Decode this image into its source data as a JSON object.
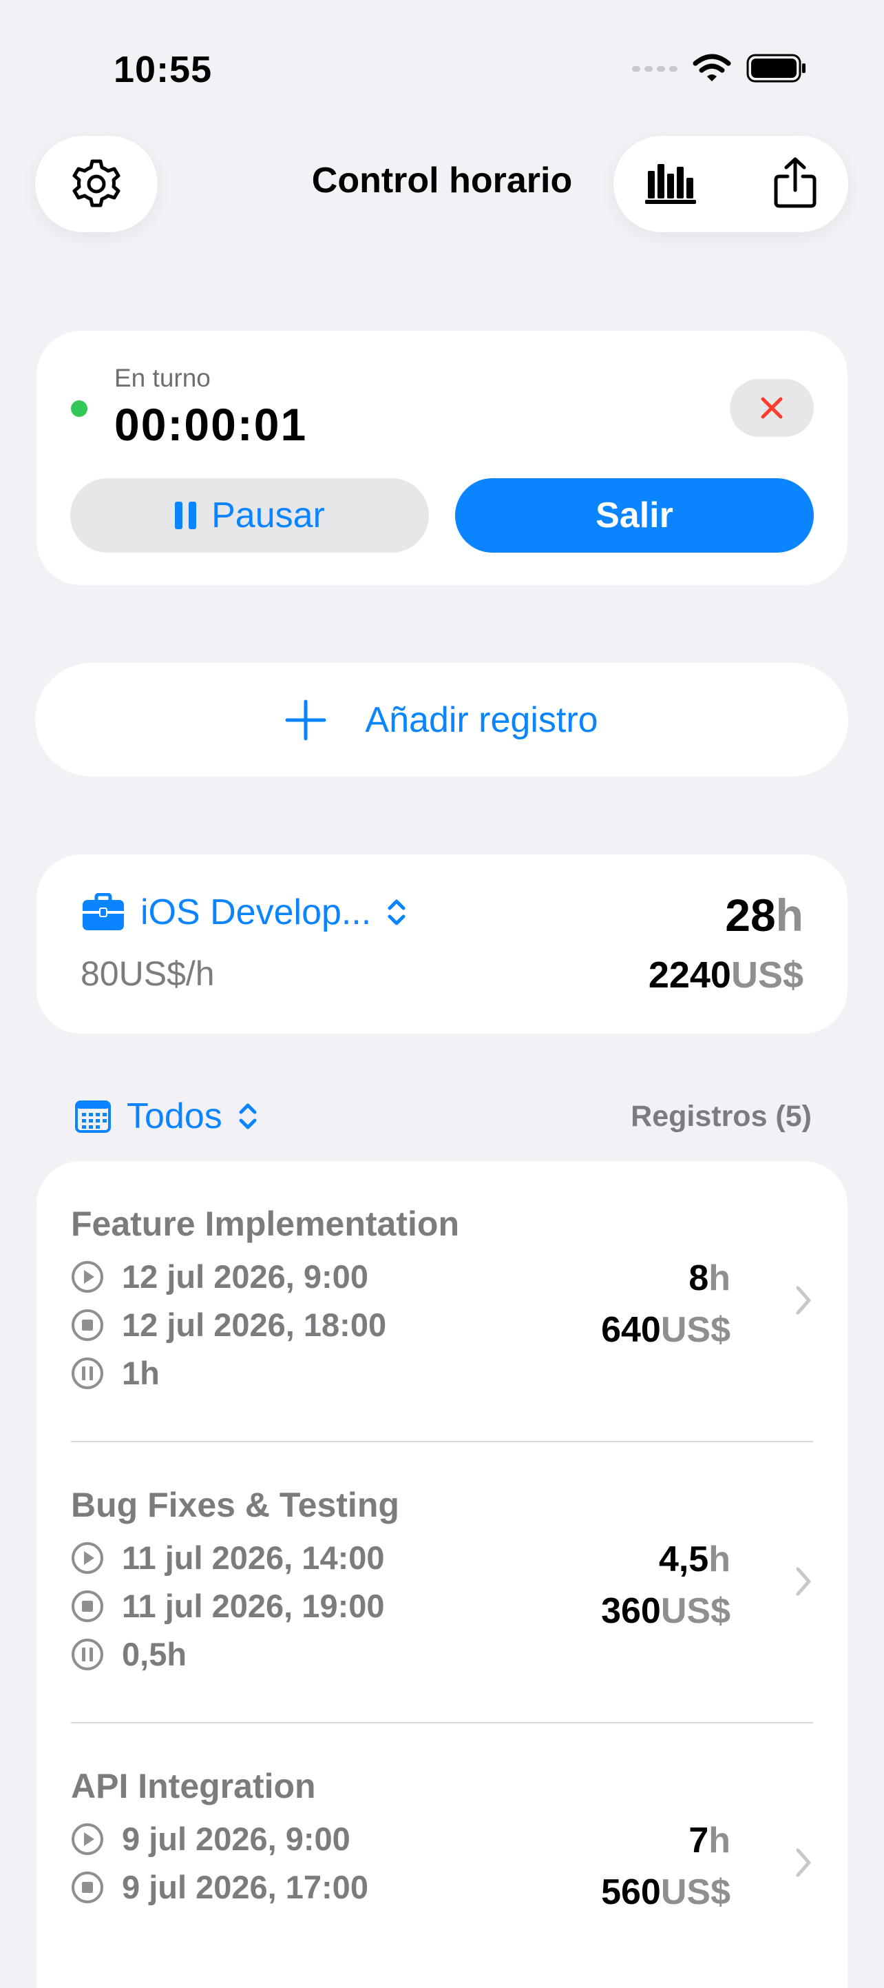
{
  "status_bar": {
    "time": "10:55"
  },
  "header": {
    "title": "Control horario"
  },
  "shift": {
    "label": "En turno",
    "timer": "00:00:01",
    "pause_label": "Pausar",
    "exit_label": "Salir"
  },
  "add_record": {
    "label": "Añadir registro"
  },
  "project": {
    "name": "iOS Develop...",
    "rate": "80US$/h",
    "hours_value": "28",
    "hours_unit": "h",
    "earnings_value": "2240",
    "earnings_unit": "US$"
  },
  "filter": {
    "label": "Todos",
    "records_count": "Registros (5)"
  },
  "entries": [
    {
      "title": "Feature Implementation",
      "start": "12 jul 2026, 9:00",
      "end": "12 jul 2026, 18:00",
      "pause": "1h",
      "hours_value": "8",
      "hours_unit": "h",
      "earnings_value": "640",
      "earnings_unit": "US$"
    },
    {
      "title": "Bug Fixes & Testing",
      "start": "11 jul 2026, 14:00",
      "end": "11 jul 2026, 19:00",
      "pause": "0,5h",
      "hours_value": "4,5",
      "hours_unit": "h",
      "earnings_value": "360",
      "earnings_unit": "US$"
    },
    {
      "title": "API Integration",
      "start": "9 jul 2026, 9:00",
      "end": "9 jul 2026, 17:00",
      "pause": "",
      "hours_value": "7",
      "hours_unit": "h",
      "earnings_value": "560",
      "earnings_unit": "US$"
    }
  ],
  "colors": {
    "accent": "#0A84FF",
    "background": "#F2F1F6",
    "active_dot": "#34C759",
    "cancel": "#FF3B30"
  },
  "icons": [
    "gear-icon",
    "bar-chart-icon",
    "share-icon",
    "close-icon",
    "pause-icon",
    "plus-icon",
    "briefcase-icon",
    "chevron-up-down-icon",
    "calendar-icon",
    "play-circle-icon",
    "stop-circle-icon",
    "pause-circle-icon",
    "chevron-right-icon"
  ]
}
